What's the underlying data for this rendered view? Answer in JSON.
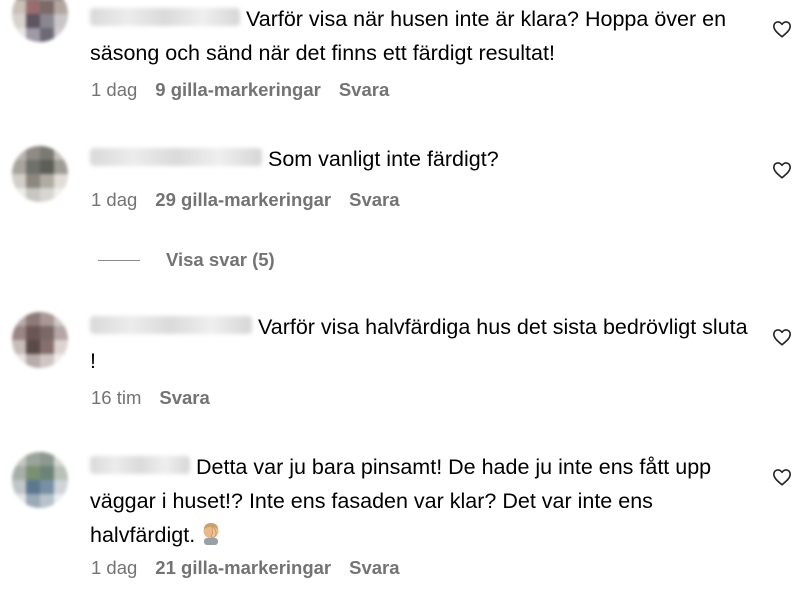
{
  "comments": [
    {
      "text": "Varför visa när husen inte är klara? Hoppa över en säsong och sänd när det finns ett färdigt resultat!",
      "time": "1 dag",
      "likes": "9 gilla-markeringar",
      "reply": "Svara"
    },
    {
      "text": "Som vanligt inte färdigt?",
      "time": "1 dag",
      "likes": "29 gilla-markeringar",
      "reply": "Svara",
      "view_replies": "Visa svar (5)"
    },
    {
      "text": "Varför visa halvfärdiga hus det sista bedrövligt sluta !",
      "time": "16 tim",
      "reply": "Svara"
    },
    {
      "text": "Detta var ju bara pinsamt! De hade ju inte ens fått upp väggar i huset!? Inte ens fasaden var klar? Det var inte ens halvfärdigt.",
      "emoji": "man-facepalming-emoji",
      "time": "1 dag",
      "likes": "21 gilla-markeringar",
      "reply": "Svara"
    }
  ],
  "icons": {
    "like": "heart-outline-icon"
  },
  "colors": {
    "text": "#000000",
    "meta": "#737373",
    "background": "#ffffff"
  }
}
